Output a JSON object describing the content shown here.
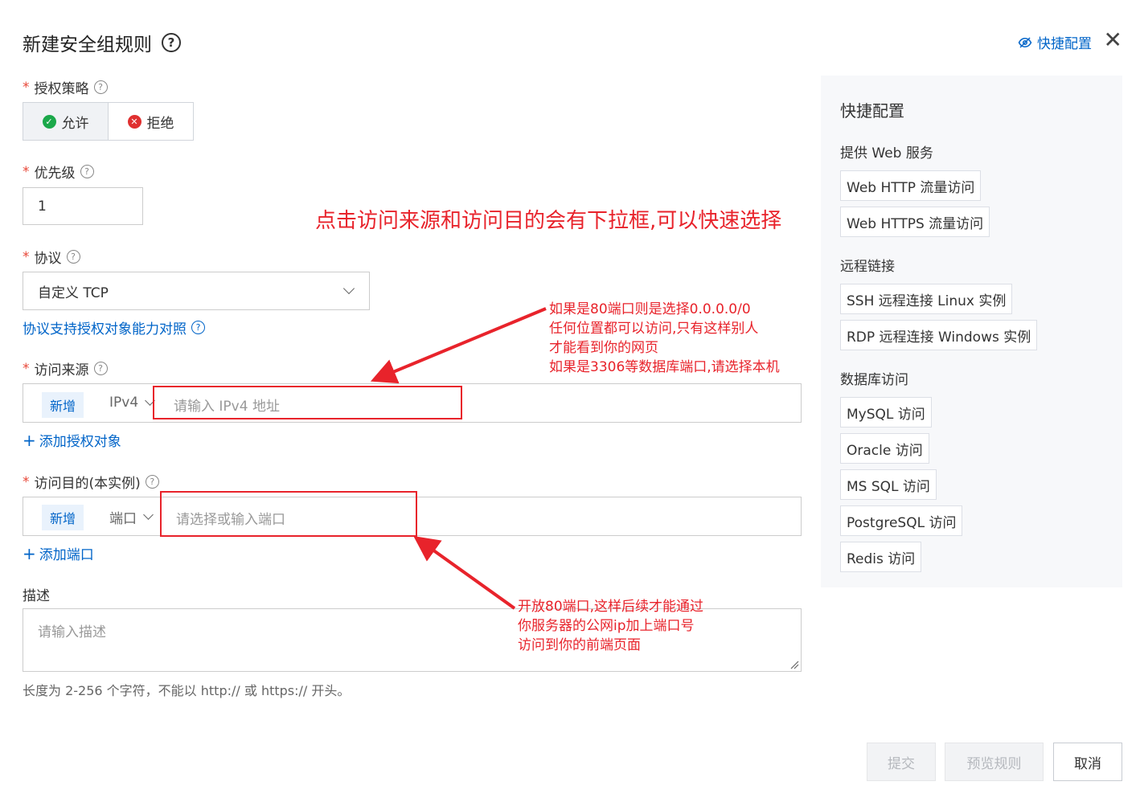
{
  "dialog": {
    "title": "新建安全组规则",
    "quick_config_link": "快捷配置",
    "close_icon": "close-icon"
  },
  "form": {
    "auth_policy": {
      "label": "授权策略",
      "options": [
        "允许",
        "拒绝"
      ],
      "selected": "允许"
    },
    "priority": {
      "label": "优先级",
      "value": "1"
    },
    "protocol": {
      "label": "协议",
      "value": "自定义 TCP",
      "help_link": "协议支持授权对象能力对照"
    },
    "source": {
      "label": "访问来源",
      "tag": "新增",
      "type": "IPv4",
      "placeholder": "请输入 IPv4 地址",
      "add_link": "添加授权对象"
    },
    "destination": {
      "label": "访问目的(本实例)",
      "tag": "新增",
      "type": "端口",
      "placeholder": "请选择或输入端口",
      "add_link": "添加端口"
    },
    "description": {
      "label": "描述",
      "placeholder": "请输入描述",
      "hint": "长度为 2-256 个字符，不能以 http:// 或 https:// 开头。"
    }
  },
  "quick_panel": {
    "title": "快捷配置",
    "sections": [
      {
        "heading": "提供 Web 服务",
        "items": [
          "Web HTTP 流量访问",
          "Web HTTPS 流量访问"
        ]
      },
      {
        "heading": "远程链接",
        "items": [
          "SSH 远程连接 Linux 实例",
          "RDP 远程连接 Windows 实例"
        ]
      },
      {
        "heading": "数据库访问",
        "items": [
          "MySQL 访问",
          "Oracle 访问",
          "MS SQL 访问",
          "PostgreSQL 访问",
          "Redis 访问"
        ]
      }
    ]
  },
  "footer": {
    "submit": "提交",
    "preview": "预览规则",
    "cancel": "取消"
  },
  "annotations": {
    "headline": "点击访问来源和访问目的会有下拉框,可以快速选择",
    "source_note": [
      "如果是80端口则是选择0.0.0.0/0",
      "任何位置都可以访问,只有这样别人",
      "才能看到你的网页",
      "如果是3306等数据库端口,请选择本机"
    ],
    "dest_note": [
      "开放80端口,这样后续才能通过",
      "你服务器的公网ip加上端口号",
      "访问到你的前端页面"
    ],
    "color": "#e8232b"
  },
  "colors": {
    "accent": "#0064c8",
    "required": "#e84738",
    "allow": "#1ba84a",
    "deny": "#e03030"
  }
}
